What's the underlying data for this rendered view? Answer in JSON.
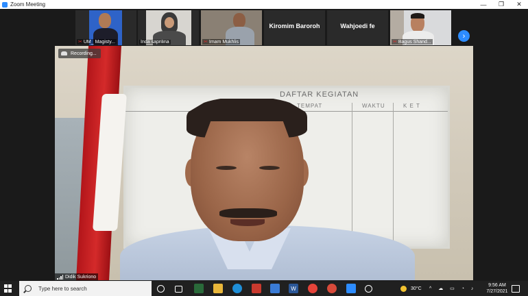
{
  "window": {
    "title": "Zoom Meeting",
    "minimize": "—",
    "maximize": "❐",
    "close": "✕"
  },
  "participants": [
    {
      "name": "UM_ Magisty...",
      "muted": true
    },
    {
      "name": "Inda saprilina",
      "muted": false
    },
    {
      "name": "Imam Mukhlis",
      "muted": true
    },
    {
      "name": "Kiromim Baroroh",
      "muted": false,
      "video": false
    },
    {
      "name": "Wahjoedi fe",
      "muted": false,
      "video": false
    },
    {
      "name": "Bagus Shand...",
      "muted": true
    }
  ],
  "gallery": {
    "next_label": "›"
  },
  "recording": {
    "label": "Recording..."
  },
  "whiteboard": {
    "title": "DAFTAR KEGIATAN",
    "col_tempat": "TEMPAT",
    "col_waktu": "WAKTU",
    "col_ket": "K E T"
  },
  "active_speaker": {
    "name": "Didik Sukriono"
  },
  "taskbar": {
    "search_placeholder": "Type here to search",
    "weather": "30°C",
    "time": "9:56 AM",
    "date": "7/27/2021"
  },
  "colors": {
    "accent": "#2d8cff",
    "muted_mic": "#e02828",
    "taskbar": "#202020"
  }
}
